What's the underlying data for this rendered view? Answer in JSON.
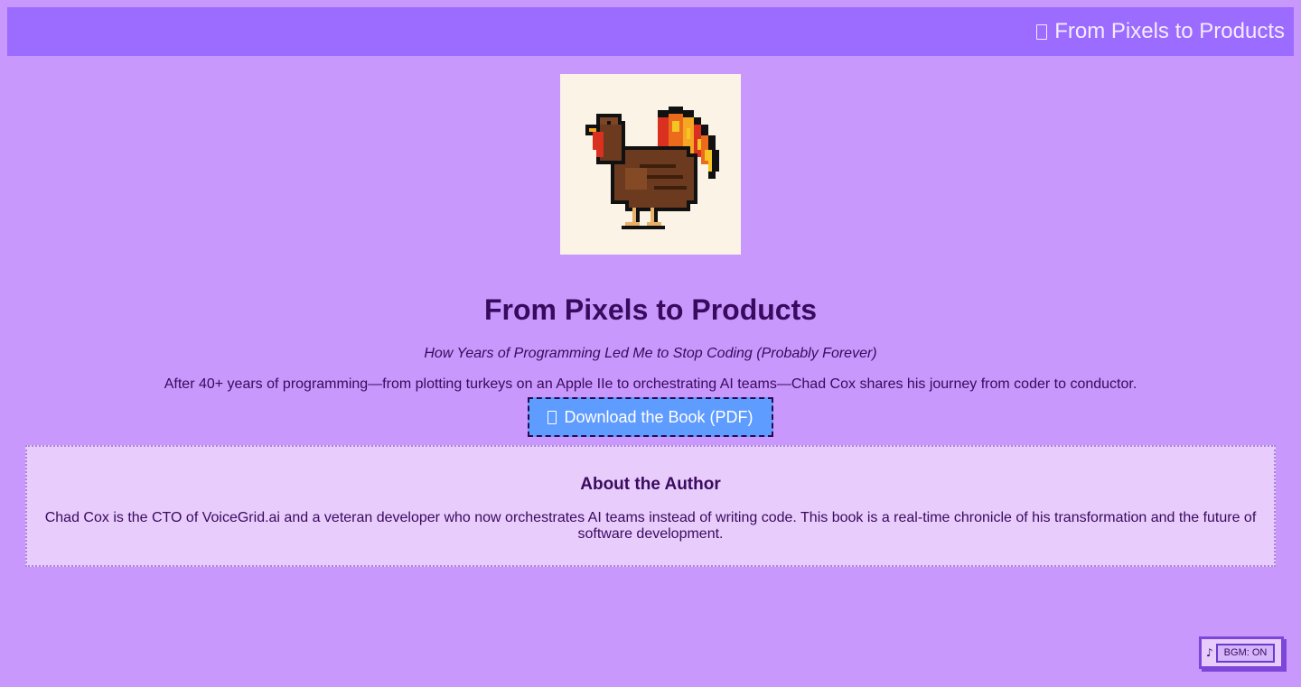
{
  "header": {
    "icon": "book-icon",
    "title": "From Pixels to Products"
  },
  "cover": {
    "image": "pixel-turkey-illustration"
  },
  "main": {
    "title": "From Pixels to Products",
    "subtitle": "How Years of Programming Led Me to Stop Coding (Probably Forever)",
    "description": "After 40+ years of programming—from plotting turkeys on an Apple IIe to orchestrating AI teams—Chad Cox shares his journey from coder to conductor.",
    "download_icon": "download-icon",
    "download_label": "Download the Book (PDF)"
  },
  "about": {
    "heading": "About the Author",
    "text": "Chad Cox is the CTO of VoiceGrid.ai and a veteran developer who now orchestrates AI teams instead of writing code. This book is a real-time chronicle of his transformation and the future of software development."
  },
  "bgm": {
    "note_icon": "music-note-icon",
    "note": "♪",
    "toggle_label": "BGM: ON"
  },
  "colors": {
    "background": "#c898fc",
    "header_bar": "#9c6bff",
    "text": "#3a0a5e",
    "button": "#5f9cff",
    "about_panel": "#e8ccfc"
  }
}
